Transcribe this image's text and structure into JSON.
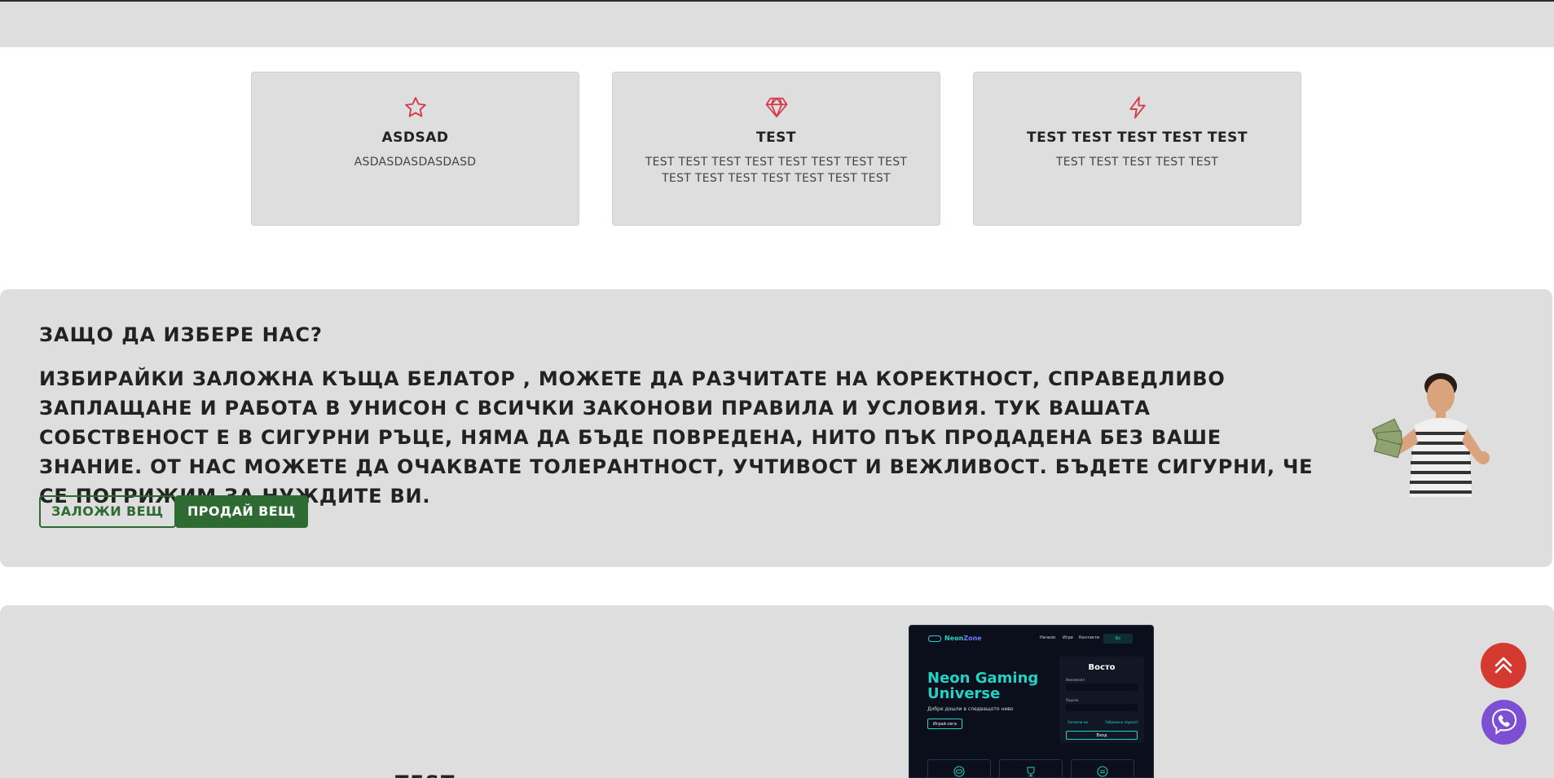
{
  "features": [
    {
      "icon": "star-icon",
      "title": "ASDSAD",
      "desc": "ASDASDASDASDASD"
    },
    {
      "icon": "diamond-icon",
      "title": "TEST",
      "desc": "TEST TEST TEST TEST TEST TEST TEST TEST TEST TEST TEST TEST TEST TEST TEST"
    },
    {
      "icon": "lightning-icon",
      "title": "TEST TEST TEST TEST TEST",
      "desc": "TEST TEST TEST TEST TEST"
    }
  ],
  "why": {
    "heading": "ЗАЩО ДА ИЗБЕРЕ НАС?",
    "text": "ИЗБИРАЙКИ ЗАЛОЖНА КЪЩА БЕЛАТОР , МОЖЕТЕ ДА РАЗЧИТАТЕ НА КОРЕКТНОСТ, СПРАВЕДЛИВО ЗАПЛАЩАНЕ И РАБОТА В УНИСОН С ВСИЧКИ ЗАКОНОВИ ПРАВИЛА И УСЛОВИЯ. ТУК ВАШАТА СОБСТВЕНОСТ Е В СИГУРНИ РЪЦЕ, НЯМА ДА БЪДЕ ПОВРЕДЕНА, НИТО ПЪК ПРОДАДЕНА БЕЗ ВАШЕ ЗНАНИЕ. ОТ НАС МОЖЕТЕ ДА ОЧАКВАТЕ ТОЛЕРАНТНОСТ, УЧТИВОСТ И ВЕЖЛИВОСТ. БЪДЕТЕ СИГУРНИ, ЧЕ СЕ ПОГРИЖИМ ЗА НУЖДИТЕ ВИ.",
    "btn_pawn": "ЗАЛОЖИ ВЕЩ",
    "btn_sell": "ПРОДАЙ ВЕЩ"
  },
  "lower": {
    "heading": "TEST",
    "mockup": {
      "logo_prefix": "Neon",
      "logo_suffix": "Zone",
      "nav": [
        "Начало",
        "Игри",
        "Контакти"
      ],
      "nav_button": "Вх",
      "hero_title": "Neon Gaming Universe",
      "hero_sub": "Добре дошли в следващото ниво",
      "hero_button": "Играй сега",
      "panel_title": "Восто",
      "field_user": "Име/имейл",
      "field_pass": "Парола",
      "link_forgot": "Забравена парола?",
      "link_reg": "Запомни ме",
      "submit": "Вход"
    }
  },
  "colors": {
    "accent_red": "#d43a2f",
    "brand_green": "#2e6b32",
    "neon": "#22d3c5",
    "viber": "#7c4fd3"
  }
}
